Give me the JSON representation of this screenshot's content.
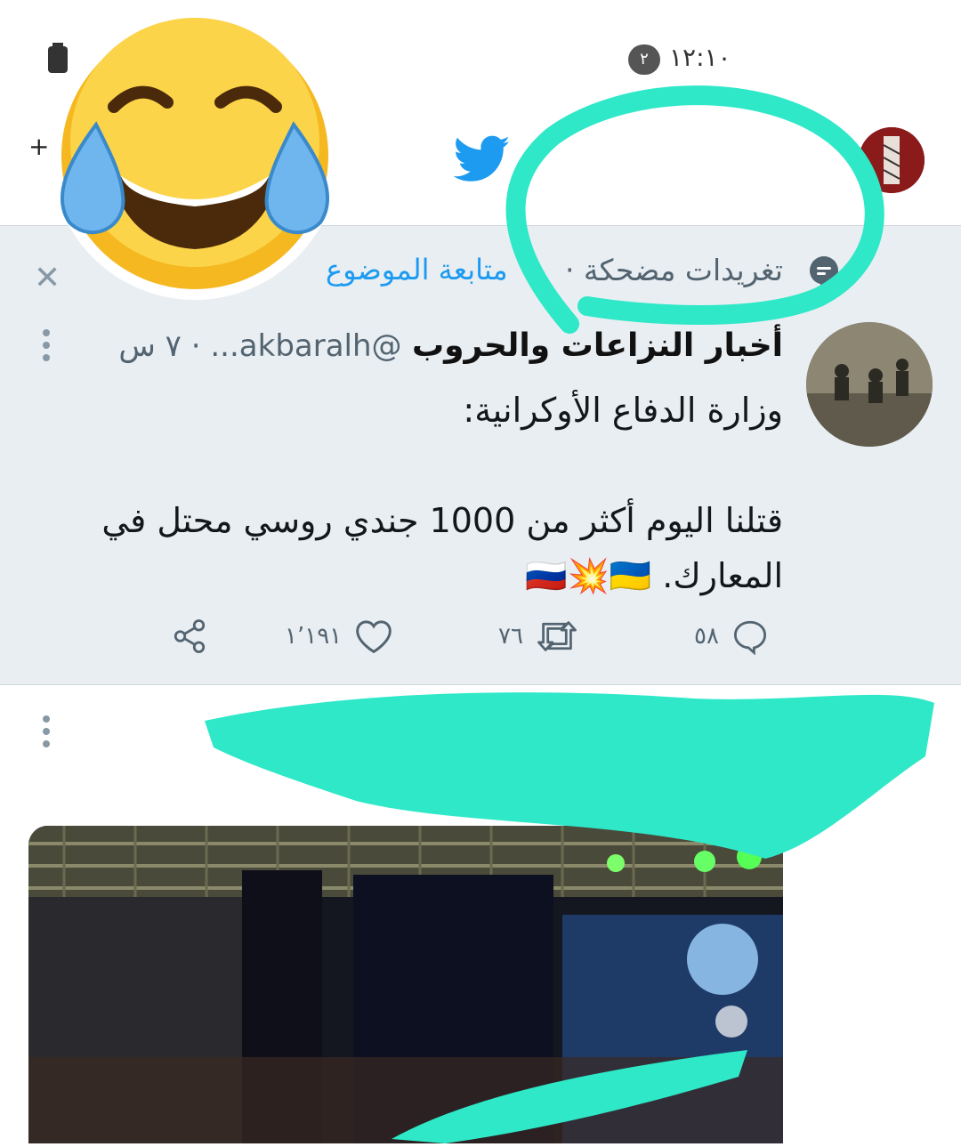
{
  "status_bar": {
    "time": "١٢:١٠",
    "badge": "٢"
  },
  "header": {
    "logo_icon": "twitter-bird-icon",
    "avatar_icon": "profile-avatar"
  },
  "context": {
    "icon": "speech-bubble-icon",
    "topic_text": "تغريدات مضحكة ·",
    "follow_text": "متابعة الموضوع",
    "dismiss_icon": "close-icon"
  },
  "tweet": {
    "author_name": "أخبار النزاعات والحروب",
    "handle": "@akbaralh... · ٧ س",
    "body": "وزارة الدفاع الأوكرانية:\n\nقتلنا اليوم أكثر من 1000 جندي روسي محتل في المعارك. 🇷🇺💥🇺🇦",
    "actions": {
      "replies": "٥٨",
      "retweets": "٧٦",
      "likes": "١٬١٩١"
    }
  },
  "colors": {
    "accent": "#1d9bf0",
    "panel_bg": "#e9eef2",
    "scribble": "#2ee8c8"
  }
}
